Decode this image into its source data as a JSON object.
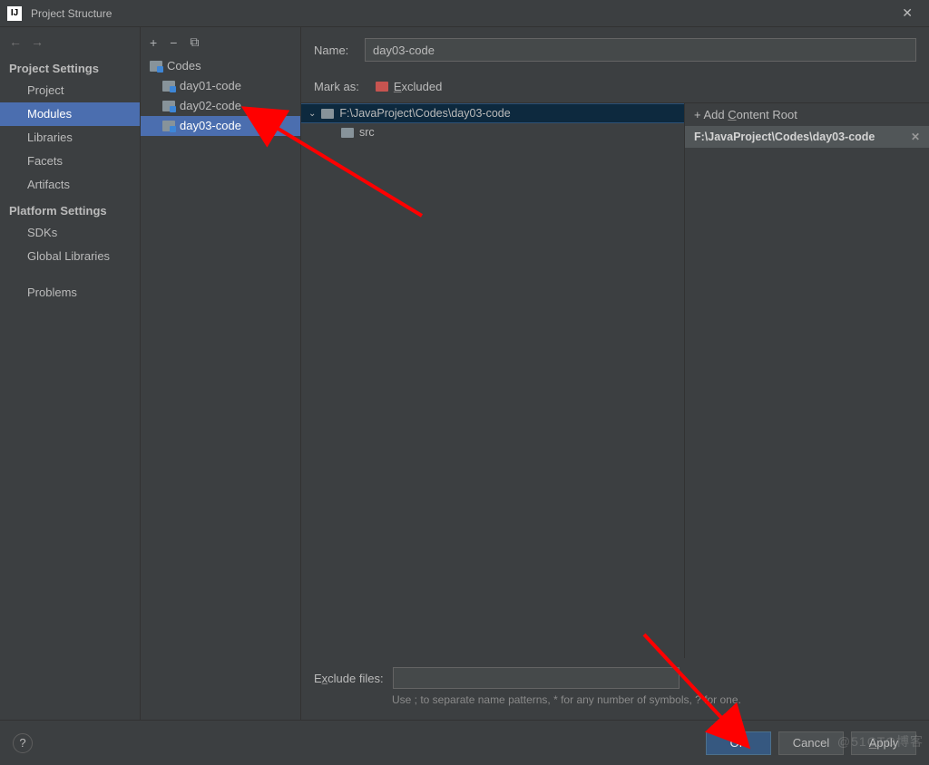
{
  "window": {
    "title": "Project Structure"
  },
  "nav": {
    "back_arrow": "←",
    "fwd_arrow": "→",
    "heading1": "Project Settings",
    "items1": [
      "Project",
      "Modules",
      "Libraries",
      "Facets",
      "Artifacts"
    ],
    "heading2": "Platform Settings",
    "items2": [
      "SDKs",
      "Global Libraries"
    ],
    "problems": "Problems"
  },
  "modules": {
    "toolbar": {
      "add": "+",
      "remove": "−",
      "copy": "⧉"
    },
    "tree": [
      {
        "name": "Codes",
        "level": 0
      },
      {
        "name": "day01-code",
        "level": 1
      },
      {
        "name": "day02-code",
        "level": 1
      },
      {
        "name": "day03-code",
        "level": 1,
        "selected": true
      }
    ]
  },
  "details": {
    "name_label": "Name:",
    "name_value": "day03-code",
    "markas_label": "Mark as:",
    "excluded_label": "Excluded",
    "source_root": "F:\\JavaProject\\Codes\\day03-code",
    "src_folder": "src",
    "add_root": "+ Add Content Root",
    "content_root": "F:\\JavaProject\\Codes\\day03-code",
    "exclude_label": "Exclude files:",
    "exclude_hint": "Use ; to separate name patterns, * for any number of symbols, ? for one."
  },
  "footer": {
    "help": "?",
    "ok": "OK",
    "cancel": "Cancel",
    "apply": "Apply"
  },
  "watermark": "@51CTO博客"
}
